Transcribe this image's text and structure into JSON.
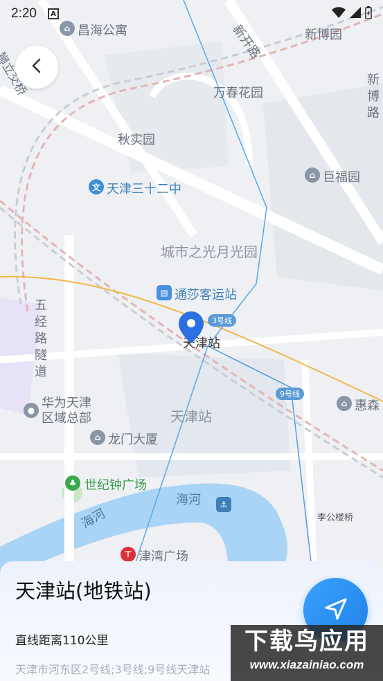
{
  "status_bar": {
    "time": "2:20",
    "notification_icon": "A"
  },
  "map": {
    "labels": {
      "changhai": "昌海公寓",
      "xinkai_road": "新开路",
      "xinbo_garden": "新博园",
      "xinbo_road": "新博路",
      "bridge": "狮立交桥",
      "wanchun": "万春花园",
      "qiushi": "秋实园",
      "jufu": "巨福园",
      "school": "天津三十二中",
      "city_light": "城市之光月光园",
      "tongsha": "通莎客运站",
      "station_poi": "天津站",
      "line3": "3号线",
      "line9": "9号线",
      "wujing_road": "五经路隧道",
      "huawei": "华为天津区域总部",
      "huisen": "惠森",
      "station_area": "天津站",
      "longmen": "龙门大厦",
      "century_clock": "世纪钟广场",
      "haihe_1": "海河",
      "haihe_2": "海河",
      "ligonglou": "李公楼桥",
      "jinwan": "津湾广场"
    }
  },
  "back_button": {
    "icon": "chevron-left-icon"
  },
  "sheet": {
    "title": "天津站(地铁站)",
    "distance": "直线距离110公里",
    "address": "天津市河东区2号线;3号线;9号线天津站"
  },
  "navigate_button": {
    "icon": "navigation-arrow-icon"
  },
  "watermark": {
    "big": "下载鸟应用",
    "small": "www.xiazainiao.com"
  },
  "colors": {
    "accent": "#2b8cf0",
    "water": "#a9d4f5",
    "rail": "#e3b5b5",
    "road_yellow": "#f2b84b"
  }
}
